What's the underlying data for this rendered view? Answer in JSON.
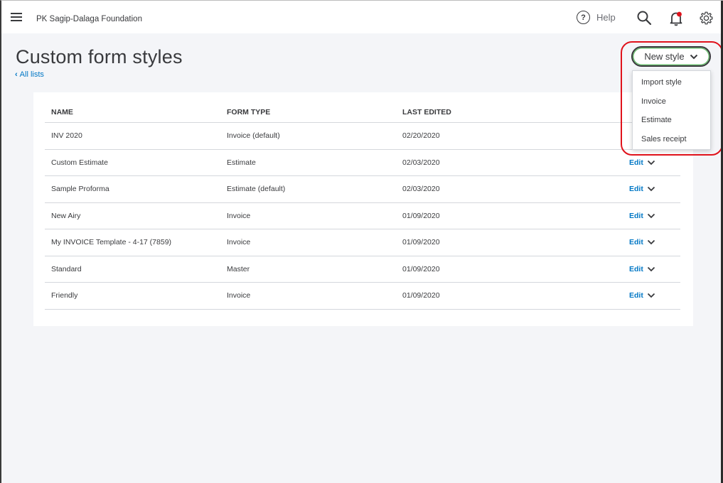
{
  "topbar": {
    "company": "PK Sagip-Dalaga Foundation",
    "help_label": "Help",
    "help_glyph": "?",
    "icons": [
      "hamburger-icon",
      "help-icon",
      "search-icon",
      "bell-icon",
      "gear-icon"
    ]
  },
  "page": {
    "title": "Custom form styles",
    "back_link": "All lists"
  },
  "new_style": {
    "label": "New style",
    "menu": [
      "Import style",
      "Invoice",
      "Estimate",
      "Sales receipt"
    ]
  },
  "table": {
    "headers": [
      "NAME",
      "FORM TYPE",
      "LAST EDITED"
    ],
    "edit_label": "Edit",
    "rows": [
      {
        "name": "INV 2020",
        "type": "Invoice (default)",
        "date": "02/20/2020"
      },
      {
        "name": "Custom Estimate",
        "type": "Estimate",
        "date": "02/03/2020"
      },
      {
        "name": "Sample Proforma",
        "type": "Estimate (default)",
        "date": "02/03/2020"
      },
      {
        "name": "New Airy",
        "type": "Invoice",
        "date": "01/09/2020"
      },
      {
        "name": "My INVOICE Template - 4-17 (7859)",
        "type": "Invoice",
        "date": "01/09/2020"
      },
      {
        "name": "Standard",
        "type": "Master",
        "date": "01/09/2020"
      },
      {
        "name": "Friendly",
        "type": "Invoice",
        "date": "01/09/2020"
      }
    ]
  },
  "colors": {
    "link": "#0077c5",
    "highlight": "#e0121b",
    "text": "#393a3d",
    "background": "#f4f5f8",
    "notification_dot": "#e0121b"
  }
}
